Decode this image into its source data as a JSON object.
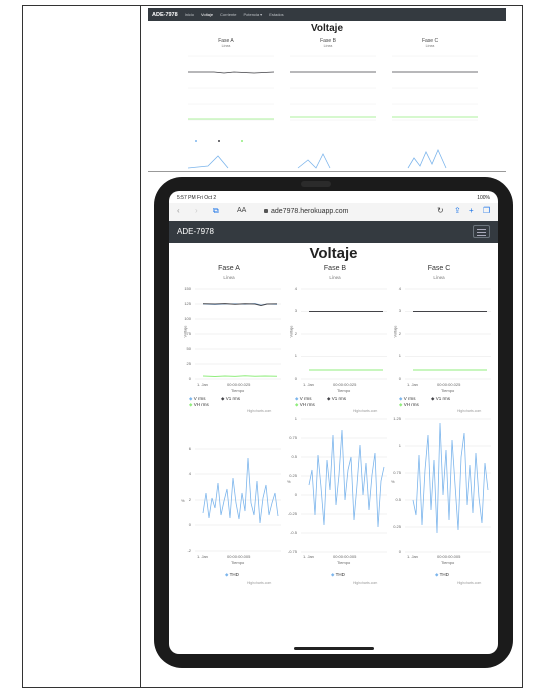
{
  "top_screenshot": {
    "nav": {
      "brand": "ADE-7978",
      "items": [
        "Inicio",
        "Voltaje",
        "Corriente",
        "Potencia ▾",
        "Estados"
      ]
    },
    "title": "Voltaje",
    "charts": [
      {
        "title": "Fase A",
        "subtitle": "Línea"
      },
      {
        "title": "Fase B",
        "subtitle": "Línea"
      },
      {
        "title": "Fase C",
        "subtitle": "Línea"
      }
    ]
  },
  "ipad": {
    "status": {
      "time": "5:57 PM  Fri Oct 2",
      "battery": "100%"
    },
    "browser": {
      "text_size": "AA",
      "url": "ade7978.herokuapp.com"
    },
    "navbar": {
      "brand": "ADE-7978"
    },
    "heading": "Voltaje",
    "columns": [
      {
        "title": "Fase A",
        "subtitle": "Línea",
        "line_chart": {
          "yticks": [
            "150",
            "125",
            "100",
            "75",
            "50",
            "25",
            "0"
          ],
          "ylabel": "Voltaje",
          "xticks": [
            "1. Jan",
            "00:00:00.025"
          ],
          "xlabel": "Tiempo",
          "legend": [
            "V rms",
            "V1 rms",
            "VH rms"
          ]
        },
        "thd_chart": {
          "yticks": [
            "6",
            "4",
            "2",
            "0",
            "-2"
          ],
          "ylabel": "%",
          "xticks": [
            "1. Jan",
            "00:00:00.005"
          ],
          "xlabel": "Tiempo",
          "legend": [
            "THD"
          ]
        }
      },
      {
        "title": "Fase B",
        "subtitle": "Línea",
        "line_chart": {
          "yticks": [
            "4",
            "3",
            "2",
            "1",
            "0"
          ],
          "ylabel": "Voltaje",
          "xticks": [
            "1. Jan",
            "00:00:00.025"
          ],
          "xlabel": "Tiempo",
          "legend": [
            "V rms",
            "V1 rms",
            "VH rms"
          ]
        },
        "thd_chart": {
          "yticks": [
            "1",
            "0.75",
            "0.5",
            "0.25",
            "0",
            "-0.25",
            "-0.5",
            "-0.75"
          ],
          "ylabel": "%",
          "xticks": [
            "1. Jan",
            "00:00:00.005"
          ],
          "xlabel": "Tiempo",
          "legend": [
            "THD"
          ]
        }
      },
      {
        "title": "Fase C",
        "subtitle": "Línea",
        "line_chart": {
          "yticks": [
            "4",
            "3",
            "2",
            "1",
            "0"
          ],
          "ylabel": "Voltaje",
          "xticks": [
            "1. Jan",
            "00:00:00.025"
          ],
          "xlabel": "Tiempo",
          "legend": [
            "V rms",
            "V1 rms",
            "VH rms"
          ]
        },
        "thd_chart": {
          "yticks": [
            "1.25",
            "1",
            "0.75",
            "0.5",
            "0.25",
            "0"
          ],
          "ylabel": "%",
          "xticks": [
            "1. Jan",
            "00:00:00.005"
          ],
          "xlabel": "Tiempo",
          "legend": [
            "THD"
          ]
        }
      }
    ],
    "credit": "Highcharts.com"
  },
  "chart_data": [
    {
      "type": "line",
      "title": "Fase A",
      "subtitle": "Línea",
      "xlabel": "Tiempo",
      "ylabel": "Voltaje",
      "ylim": [
        0,
        150
      ],
      "series": [
        {
          "name": "V rms",
          "values": [
            121,
            121,
            120.5,
            121,
            121,
            120,
            121,
            121,
            119,
            121,
            121,
            120,
            121
          ]
        },
        {
          "name": "V1 rms",
          "values": [
            121,
            121,
            120.5,
            121,
            121,
            120,
            121,
            121,
            119,
            121,
            121,
            120,
            121
          ]
        },
        {
          "name": "VH rms",
          "values": [
            2,
            2.5,
            2,
            2,
            2.5,
            2,
            2,
            2.5,
            2,
            2,
            2.5,
            2,
            2
          ]
        }
      ],
      "colors": {
        "V rms": "#7cb5ec",
        "V1 rms": "#434348",
        "VH rms": "#90ed7d"
      }
    },
    {
      "type": "line",
      "title": "Fase B",
      "subtitle": "Línea",
      "xlabel": "Tiempo",
      "ylabel": "Voltaje",
      "ylim": [
        0,
        4
      ],
      "series": [
        {
          "name": "V rms",
          "values": [
            3,
            3,
            3,
            3,
            3,
            3,
            3,
            3,
            3,
            3,
            3,
            3,
            3
          ]
        },
        {
          "name": "V1 rms",
          "values": [
            3,
            3,
            3,
            3,
            3,
            3,
            3,
            3,
            3,
            3,
            3,
            3,
            3
          ]
        },
        {
          "name": "VH rms",
          "values": [
            0.4,
            0.4,
            0.4,
            0.4,
            0.4,
            0.4,
            0.4,
            0.4,
            0.4,
            0.4,
            0.4,
            0.4,
            0.4
          ]
        }
      ]
    },
    {
      "type": "line",
      "title": "Fase C",
      "subtitle": "Línea",
      "xlabel": "Tiempo",
      "ylabel": "Voltaje",
      "ylim": [
        0,
        4
      ],
      "series": [
        {
          "name": "V rms",
          "values": [
            3,
            3,
            3,
            3,
            3,
            3,
            3,
            3,
            3,
            3,
            3,
            3,
            3
          ]
        },
        {
          "name": "V1 rms",
          "values": [
            3,
            3,
            3,
            3,
            3,
            3,
            3,
            3,
            3,
            3,
            3,
            3,
            3
          ]
        },
        {
          "name": "VH rms",
          "values": [
            0.4,
            0.4,
            0.4,
            0.4,
            0.4,
            0.4,
            0.4,
            0.4,
            0.4,
            0.4,
            0.4,
            0.4,
            0.4
          ]
        }
      ]
    },
    {
      "type": "line",
      "xlabel": "Tiempo",
      "ylabel": "%",
      "ylim": [
        -2,
        6
      ],
      "series": [
        {
          "name": "THD",
          "values": [
            1,
            3,
            0.5,
            2.5,
            1.5,
            4,
            0.8,
            2,
            3.5,
            1,
            4.5,
            2,
            0.5,
            3,
            1.2,
            5.5,
            2,
            1,
            3.8,
            0.3,
            2.5,
            4,
            1,
            2.2,
            3,
            0.8,
            1.8,
            0.5,
            2.5,
            1
          ]
        }
      ],
      "colors": {
        "THD": "#7cb5ec"
      }
    },
    {
      "type": "line",
      "xlabel": "Tiempo",
      "ylabel": "%",
      "ylim": [
        -0.75,
        1
      ],
      "series": [
        {
          "name": "THD",
          "values": [
            0.1,
            0.4,
            -0.3,
            0.6,
            0.2,
            -0.5,
            0.5,
            0.1,
            0.8,
            -0.2,
            0.3,
            0.9,
            -0.1,
            0.4,
            0.6,
            -0.4,
            0.2,
            0.7,
            0,
            0.5,
            -0.3,
            0.3,
            0.6,
            -0.5,
            0.2,
            0.4,
            -0.2,
            0.1
          ]
        }
      ]
    },
    {
      "type": "line",
      "xlabel": "Tiempo",
      "ylabel": "%",
      "ylim": [
        0,
        1.25
      ],
      "series": [
        {
          "name": "THD",
          "values": [
            0.5,
            0.3,
            0.9,
            0.2,
            0.7,
            1.1,
            0.4,
            0.8,
            0.1,
            1.2,
            0.5,
            0.9,
            0.3,
            1.0,
            0.6,
            0.2,
            0.8,
            1.1,
            0.4,
            0.7,
            0.3,
            0.9,
            0.5,
            0.2,
            0.8,
            0.6,
            0.4,
            0.7
          ]
        }
      ]
    }
  ]
}
